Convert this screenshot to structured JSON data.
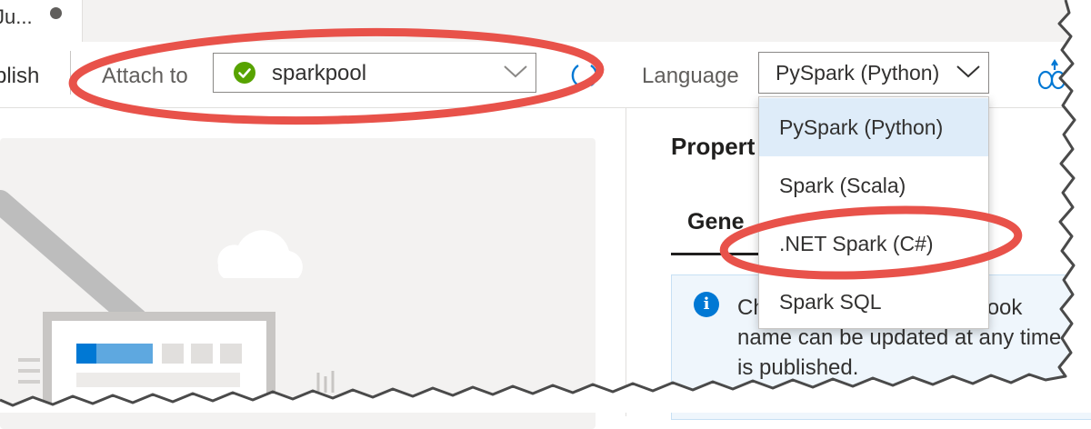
{
  "tab": {
    "title": "Ju..."
  },
  "toolbar": {
    "publish_label": "blish",
    "attach_label": "Attach to",
    "pool_value": "sparkpool",
    "language_label": "Language",
    "language_value": "PySpark (Python)"
  },
  "language_options": [
    {
      "label": "PySpark (Python)",
      "selected": true
    },
    {
      "label": "Spark (Scala)",
      "selected": false
    },
    {
      "label": ".NET Spark (C#)",
      "selected": false
    },
    {
      "label": "Spark SQL",
      "selected": false
    }
  ],
  "properties": {
    "title": "Propert",
    "general_tab": "Gene",
    "info_line1_start": "Ch",
    "info_line1_end": "otebook",
    "info_line2": "name can be updated at any time",
    "info_line3": "is published."
  },
  "colors": {
    "accent": "#0078d4",
    "status_ok": "#57a300",
    "annotation": "#e8524a",
    "selected_bg": "#deecf9"
  },
  "icons": {
    "status": "check-circle-icon",
    "refresh": "refresh-icon",
    "chevron": "chevron-down-icon",
    "info": "info-icon"
  }
}
